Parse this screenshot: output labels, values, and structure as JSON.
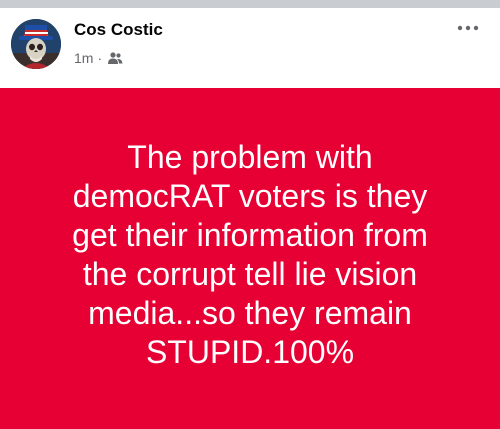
{
  "post": {
    "author": "Cos Costic",
    "timestamp": "1m",
    "separator": "·",
    "audience_icon": "friends-icon",
    "text": "The problem with\ndemocRAT voters is they\nget their information from\nthe corrupt tell lie vision\nmedia...so they remain\nSTUPID.100%"
  },
  "colors": {
    "background_color": "#e60034",
    "text_color": "#ffffff",
    "name_color": "#050505",
    "meta_color": "#65676b"
  }
}
